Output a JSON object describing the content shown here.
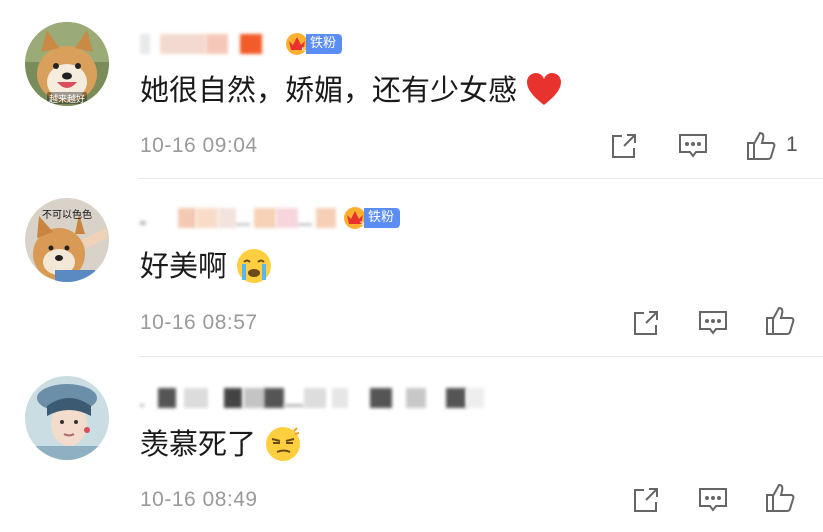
{
  "comments": [
    {
      "avatar": "shiba-dog-avatar",
      "avatar_caption": "越来越好",
      "username_blurred": true,
      "badge": {
        "level": "5",
        "label": "铁粉"
      },
      "text": "她很自然，娇媚，还有少女感",
      "emoji": "red-heart",
      "timestamp": "10-16 09:04",
      "like_count": "1"
    },
    {
      "avatar": "shiba-dog-avatar",
      "avatar_caption": "不可以色色",
      "username_blurred": true,
      "badge": {
        "level": "3",
        "label": "铁粉"
      },
      "text": "好美啊",
      "emoji": "crying-face",
      "timestamp": "10-16 08:57",
      "like_count": ""
    },
    {
      "avatar": "person-avatar",
      "avatar_caption": "",
      "username_blurred": true,
      "badge": null,
      "text": "羡慕死了",
      "emoji": "smirk-face",
      "timestamp": "10-16 08:49",
      "like_count": ""
    }
  ],
  "icons": {
    "share": "share-icon",
    "comment": "comment-icon",
    "like": "thumbs-up-icon"
  },
  "colors": {
    "badge_blue": "#5b8ef5",
    "timestamp_gray": "#9a9a9a",
    "heart_red": "#e8322e"
  }
}
